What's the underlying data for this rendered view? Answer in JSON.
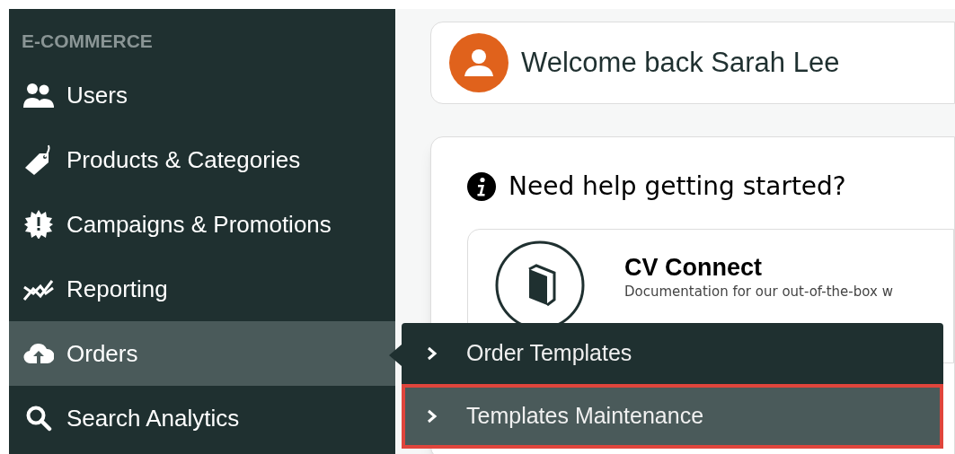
{
  "sidebar": {
    "section_title": "E-COMMERCE",
    "items": [
      {
        "label": "Users",
        "selected": false
      },
      {
        "label": "Products & Categories",
        "selected": false
      },
      {
        "label": "Campaigns & Promotions",
        "selected": false
      },
      {
        "label": "Reporting",
        "selected": false
      },
      {
        "label": "Orders",
        "selected": true
      },
      {
        "label": "Search Analytics",
        "selected": false
      }
    ]
  },
  "submenu": {
    "items": [
      {
        "label": "Order Templates",
        "selected": false
      },
      {
        "label": "Templates Maintenance",
        "selected": true
      }
    ]
  },
  "welcome": {
    "text": "Welcome back Sarah Lee"
  },
  "help": {
    "title": "Need help getting started?",
    "resources": [
      {
        "title": "CV Connect",
        "description": "Documentation for our out-of-the-box w"
      }
    ]
  }
}
